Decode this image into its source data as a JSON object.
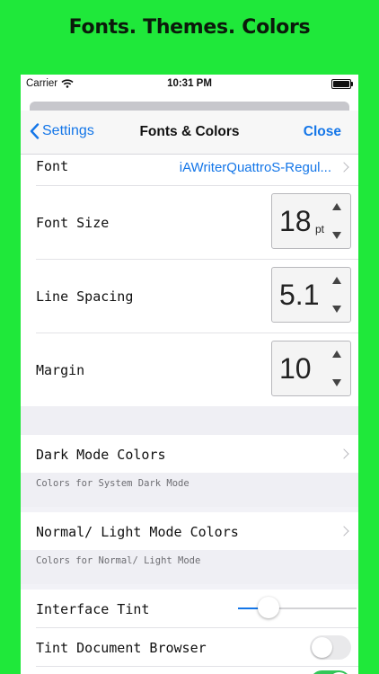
{
  "promo_title": "Fonts. Themes. Colors",
  "status": {
    "carrier": "Carrier",
    "time": "10:31 PM"
  },
  "nav": {
    "back_label": "Settings",
    "title": "Fonts & Colors",
    "close_label": "Close"
  },
  "font": {
    "label": "Font",
    "value": "iAWriterQuattroS-Regul..."
  },
  "font_size": {
    "label": "Font Size",
    "value": "18",
    "unit": "pt"
  },
  "line_spacing": {
    "label": "Line Spacing",
    "value": "5.1"
  },
  "margin": {
    "label": "Margin",
    "value": "10"
  },
  "dark_mode": {
    "label": "Dark Mode Colors",
    "caption": "Colors for System Dark Mode"
  },
  "light_mode": {
    "label": "Normal/ Light Mode Colors",
    "caption": "Colors for Normal/ Light Mode"
  },
  "interface_tint": {
    "label": "Interface Tint",
    "slider_fraction": 0.26
  },
  "tint_browser": {
    "label": "Tint Document Browser",
    "on": false
  },
  "colors": {
    "background": "#1fe83a",
    "accent": "#1476e8",
    "toggle_on": "#34c759"
  }
}
